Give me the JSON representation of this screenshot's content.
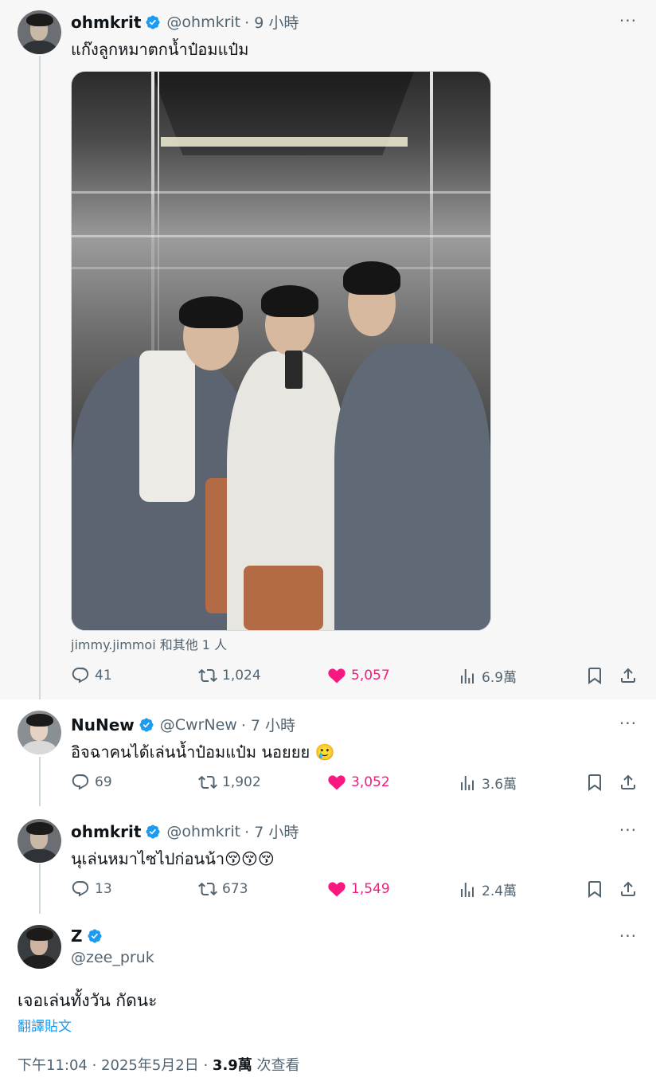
{
  "tweets": [
    {
      "name": "ohmkrit",
      "handle": "@ohmkrit",
      "time": "· 9 小時",
      "text": "แก๊งลูกหมาตกน้ำป๋อมแป๋ม",
      "tagged": "jimmy.jimmoi 和其他 1 人",
      "replies": "41",
      "retweets": "1,024",
      "likes": "5,057",
      "views": "6.9萬"
    },
    {
      "name": "NuNew",
      "handle": "@CwrNew",
      "time": "· 7 小時",
      "text": "อิจฉาคนได้เล่นน้ำป๋อมแป๋ม นอยยย",
      "emoji": "🥲",
      "replies": "69",
      "retweets": "1,902",
      "likes": "3,052",
      "views": "3.6萬"
    },
    {
      "name": "ohmkrit",
      "handle": "@ohmkrit",
      "time": "· 7 小時",
      "text": "นุเล่นหมาไซไปก่อนน้า",
      "emoji": "😚😚😚",
      "replies": "13",
      "retweets": "673",
      "likes": "1,549",
      "views": "2.4萬"
    }
  ],
  "main": {
    "name": "Z",
    "handle": "@zee_pruk",
    "text": "เจอเล่นทั้งวัน กัดนะ",
    "translate": "翻譯貼文",
    "time": "下午11:04 · 2025年5月2日 · ",
    "views_count": "3.9萬",
    "views_label": " 次查看"
  },
  "more_label": "···",
  "colors": {
    "like": "#f91880",
    "verified": "#1d9bf0",
    "muted": "#536471"
  }
}
